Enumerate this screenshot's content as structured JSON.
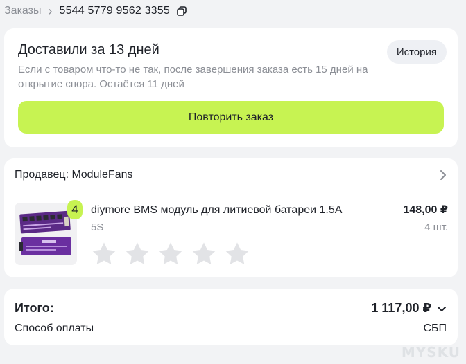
{
  "breadcrumb": {
    "root": "Заказы",
    "separator": "›",
    "order_number": "5544 5779 9562 3355"
  },
  "delivery": {
    "title": "Доставили за 13 дней",
    "note": "Если с товаром что-то не так, после завершения заказа есть 15 дней на открытие спора. Остаётся 11 дней",
    "history_label": "История",
    "repeat_label": "Повторить заказ"
  },
  "seller": {
    "label": "Продавец: ModuleFans"
  },
  "product": {
    "quantity_badge": "4",
    "name": "diymore BMS модуль для литиевой батареи 1.5A",
    "variant": "5S",
    "price": "148,00 ₽",
    "quantity": "4 шт.",
    "rating_stars": 5,
    "rating_value": 0
  },
  "total": {
    "label": "Итого:",
    "value": "1 117,00 ₽",
    "payment_label": "Способ оплаты",
    "payment_value": "СБП"
  },
  "watermark": "MYSKU",
  "colors": {
    "accent_lime": "#c7f352",
    "background": "#f2f3f5",
    "card": "#ffffff",
    "muted_text": "#8c8f96",
    "star_empty": "#e2e3e6"
  }
}
